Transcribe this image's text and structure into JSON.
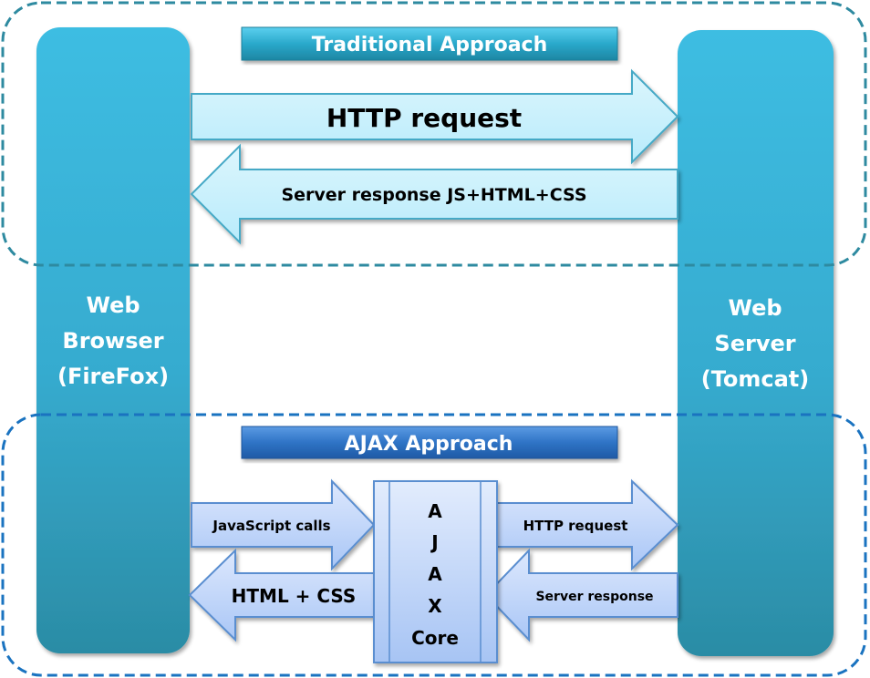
{
  "traditional": {
    "title": "Traditional Approach",
    "request_label": "HTTP request",
    "response_label": "Server response JS+HTML+CSS"
  },
  "ajax": {
    "title": "AJAX Approach",
    "js_calls_label": "JavaScript calls",
    "html_css_label": "HTML + CSS",
    "request_label": "HTTP request",
    "response_label": "Server response",
    "core_letters": [
      "A",
      "J",
      "A",
      "X",
      "Core"
    ]
  },
  "browser": {
    "lines": [
      "Web",
      "Browser",
      "(FireFox)"
    ]
  },
  "server": {
    "lines": [
      "Web",
      "Server",
      "(Tomcat)"
    ]
  },
  "colors": {
    "traditional_border": "#2e8aa0",
    "ajax_border": "#1a73c0",
    "column_top": "#3cbbe0",
    "column_bottom": "#2d8fa8",
    "trad_arrow_fill": "#cdf1fc",
    "trad_arrow_stroke": "#45a9c6",
    "ajax_arrow_fill": "#c2d6fb",
    "ajax_arrow_stroke": "#5a8ed0",
    "trad_banner": "#2aa4c4",
    "ajax_banner": "#2f6fc0"
  }
}
